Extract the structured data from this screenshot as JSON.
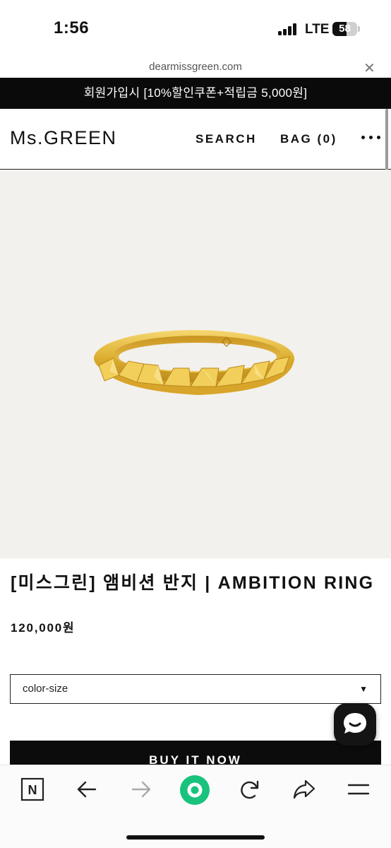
{
  "status_bar": {
    "time": "1:56",
    "network": "LTE",
    "battery": "58",
    "battery_level": 0.58
  },
  "browser": {
    "url": "dearmissgreen.com",
    "close_icon": "close-icon"
  },
  "promo": {
    "text": "회원가입시 [10%할인쿠폰+적립금 5,000원]"
  },
  "header": {
    "logo": "Ms.GREEN",
    "search_label": "SEARCH",
    "bag_label": "BAG (0)",
    "more_icon": "more-dots-icon"
  },
  "product": {
    "image_alt_icon": "gold-ring-image",
    "title": "[미스그린] 앰비션 반지 | AMBITION RING",
    "price": "120,000원",
    "option": {
      "selected": "color-size"
    },
    "buy_label": "BUY IT NOW"
  },
  "chat": {
    "icon": "chat-bubble-icon"
  },
  "toolbar": {
    "items": [
      "naver-n-icon",
      "back-arrow-icon",
      "forward-arrow-icon",
      "green-dot-icon",
      "reload-icon",
      "share-icon",
      "menu-icon"
    ]
  },
  "colors": {
    "accent_green": "#19c37d",
    "promo_bg": "#0a0a0a",
    "image_bg": "#f3f1ed",
    "gold": "#e0b63a"
  }
}
